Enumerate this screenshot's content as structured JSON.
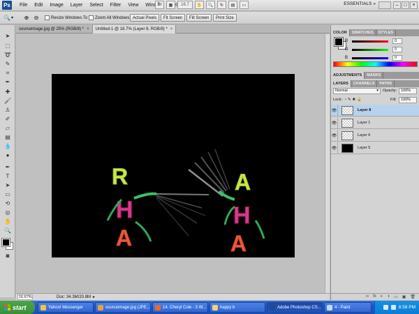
{
  "app": {
    "logo": "Ps",
    "menus": [
      "File",
      "Edit",
      "Image",
      "Layer",
      "Select",
      "Filter",
      "View",
      "Window",
      "Help"
    ],
    "zoom_box": "16.7",
    "workspace": "ESSENTIALS",
    "window_buttons": [
      "–",
      "□",
      "×"
    ]
  },
  "options_bar": {
    "resize_windows": "Resize Windows To Fit",
    "zoom_all": "Zoom All Windows",
    "actual_pixels": "Actual Pixels",
    "fit_screen": "Fit Screen",
    "fill_screen": "Fill Screen",
    "print_size": "Print Size"
  },
  "document_tabs": [
    {
      "label": "sourceimage.jpg @ 25% (RGB/8) *",
      "close": "×",
      "active": false
    },
    {
      "label": "Untitled-1 @ 16.7% (Layer 8, RGB/8) *",
      "close": "×",
      "active": true
    }
  ],
  "status": {
    "zoom": "16.67%",
    "doc": "Doc: 34.3M/20.8M",
    "arrow": "▸"
  },
  "color_panel": {
    "tabs": [
      "COLOR",
      "SWATCHES",
      "STYLES"
    ],
    "channels": [
      {
        "label": "R",
        "value": "0"
      },
      {
        "label": "G",
        "value": "0"
      },
      {
        "label": "B",
        "value": "0"
      }
    ]
  },
  "adjust_tabs": [
    "ADJUSTMENTS",
    "MASKS"
  ],
  "layers_panel": {
    "tabs": [
      "LAYERS",
      "CHANNELS",
      "PATHS"
    ],
    "blend_mode": "Normal",
    "opacity_label": "Opacity:",
    "opacity": "100%",
    "lock_label": "Lock:",
    "fill_label": "Fill:",
    "fill": "100%",
    "layers": [
      {
        "name": "Layer 8",
        "selected": true,
        "thumb": "transparent"
      },
      {
        "name": "Layer 1",
        "selected": false,
        "thumb": "transparent"
      },
      {
        "name": "Layer 6",
        "selected": false,
        "thumb": "transparent"
      },
      {
        "name": "Layer 5",
        "selected": false,
        "thumb": "black"
      }
    ],
    "footer_icons": [
      "∞",
      "fx",
      "◐",
      "◑",
      "▭",
      "▣",
      "🗑"
    ]
  },
  "taskbar": {
    "start": "start",
    "tasks": [
      {
        "label": "Yahoo! Messenger",
        "color": "#f2c53d",
        "active": false
      },
      {
        "label": "sourceimage.jpg (JPE...",
        "color": "#e8a23b",
        "active": false
      },
      {
        "label": "14. Cheryl Cole - 3 W...",
        "color": "#e86a2b",
        "active": false
      },
      {
        "label": "happy b",
        "color": "#f5d36b",
        "active": false
      },
      {
        "label": "Adobe Photoshop CS...",
        "color": "#1a4f8f",
        "active": true
      },
      {
        "label": "4 - Paint",
        "color": "#c7d9ef",
        "active": false
      }
    ],
    "clock": "8:58 PM"
  }
}
